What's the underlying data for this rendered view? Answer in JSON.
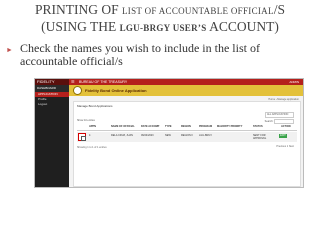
{
  "title": {
    "line1_a": "PRINTING OF",
    "line1_b": "LIST OF ACCOUNTABLE OFFICIAL",
    "line1_c": "/S",
    "line2_a": "(USING THE",
    "line2_b": "LGU-BRGY USER’S",
    "line2_c": "ACCOUNT)"
  },
  "bullet": "Check the names you wish to include in the list of accountable official/s",
  "screenshot": {
    "brand": "FIDELITY",
    "bureau": "BUREAU OF THE TREASURY",
    "user": "ADMIN",
    "banner_title": "Fidelity Bond Online Application",
    "breadcrumb": "Home › Manage application",
    "sidebar": [
      "DASHBOARD",
      "APPLICATION",
      "Profile",
      "Logout"
    ],
    "card_title": "Manage Bond Applications",
    "select_value": "ALL APPLICATION",
    "show_label": "Show  10  entries",
    "search_label": "Search:",
    "columns": [
      "APPN",
      "NAME OF OFFICIAL",
      "DATE ACCOMP",
      "TYPE",
      "REGION",
      "PROGRAM",
      "MAJORITY PRIORITY",
      "STATUS",
      "ACTION"
    ],
    "row": {
      "appn": "4",
      "name": "DELA CRUZ, JUAN",
      "date": "09/24/2023",
      "type": "NEW",
      "region": "REGION II",
      "program": "LGU-BRGY",
      "status": "SENT FOR APPROVAL",
      "action": "EDIT"
    },
    "showing": "Showing 1 to 1 of 1 entries",
    "pagination": "Previous  1  Next"
  }
}
